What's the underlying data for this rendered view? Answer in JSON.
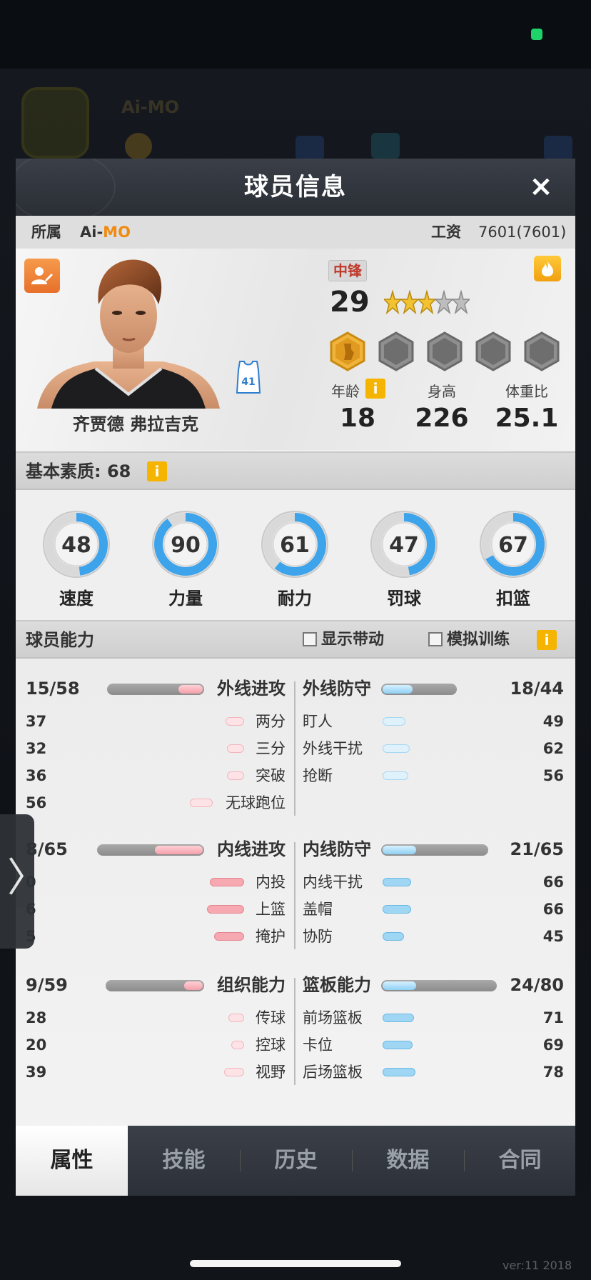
{
  "window": {
    "version": "ver:11  2018"
  },
  "background": {
    "team_name": "Ai-MO"
  },
  "panel": {
    "title": "球员信息",
    "close_icon": "×",
    "belong_label": "所属",
    "team_prefix": "Ai-",
    "team_suffix": "MO",
    "salary_label": "工资",
    "salary_value": "7601(7601)"
  },
  "player": {
    "name": "齐贾德 弗拉吉克",
    "jersey_number": "41",
    "position": "中锋",
    "overall": "29",
    "stars": {
      "filled": 3,
      "total": 5
    },
    "badges": {
      "active": 1,
      "total": 5
    },
    "age_label": "年龄",
    "age": "18",
    "height_label": "身高",
    "height": "226",
    "ratio_label": "体重比",
    "ratio": "25.1"
  },
  "basic": {
    "title": "基本素质: 68",
    "info": "i",
    "attributes": [
      {
        "label": "速度",
        "value": "48",
        "pct": 48
      },
      {
        "label": "力量",
        "value": "90",
        "pct": 90
      },
      {
        "label": "耐力",
        "value": "61",
        "pct": 61
      },
      {
        "label": "罚球",
        "value": "47",
        "pct": 47
      },
      {
        "label": "扣篮",
        "value": "67",
        "pct": 67
      }
    ]
  },
  "ability": {
    "title": "球员能力",
    "toggle_dribble": "显示带动",
    "toggle_sim": "模拟训练",
    "info": "i",
    "groups": [
      {
        "left": {
          "name": "外线进攻",
          "value": "15/58",
          "ratio": 0.26
        },
        "right": {
          "name": "外线防守",
          "value": "18/44",
          "ratio": 0.41
        },
        "left_items": [
          {
            "label": "两分",
            "value": "37"
          },
          {
            "label": "三分",
            "value": "32"
          },
          {
            "label": "突破",
            "value": "36"
          },
          {
            "label": "无球跑位",
            "value": "56"
          }
        ],
        "right_items": [
          {
            "label": "盯人",
            "value": "49"
          },
          {
            "label": "外线干扰",
            "value": "62"
          },
          {
            "label": "抢断",
            "value": "56"
          }
        ]
      },
      {
        "left": {
          "name": "内线进攻",
          "value": "8/65",
          "ratio": 0.46
        },
        "right": {
          "name": "内线防守",
          "value": "21/65",
          "ratio": 0.32
        },
        "left_items": [
          {
            "label": "内投",
            "value": "0"
          },
          {
            "label": "上篮",
            "value": "6"
          },
          {
            "label": "掩护",
            "value": "5"
          }
        ],
        "right_items": [
          {
            "label": "内线干扰",
            "value": "66"
          },
          {
            "label": "盖帽",
            "value": "66"
          },
          {
            "label": "协防",
            "value": "45"
          }
        ]
      },
      {
        "left": {
          "name": "组织能力",
          "value": "9/59",
          "ratio": 0.15
        },
        "right": {
          "name": "篮板能力",
          "value": "24/80",
          "ratio": 0.3
        },
        "left_items": [
          {
            "label": "传球",
            "value": "28"
          },
          {
            "label": "控球",
            "value": "20"
          },
          {
            "label": "视野",
            "value": "39"
          }
        ],
        "right_items": [
          {
            "label": "前场篮板",
            "value": "71"
          },
          {
            "label": "卡位",
            "value": "69"
          },
          {
            "label": "后场篮板",
            "value": "78"
          }
        ]
      }
    ]
  },
  "tabs": [
    {
      "label": "属性"
    },
    {
      "label": "技能"
    },
    {
      "label": "历史"
    },
    {
      "label": "数据"
    },
    {
      "label": "合同"
    }
  ],
  "side_handle": {
    "chevron": "〉"
  }
}
